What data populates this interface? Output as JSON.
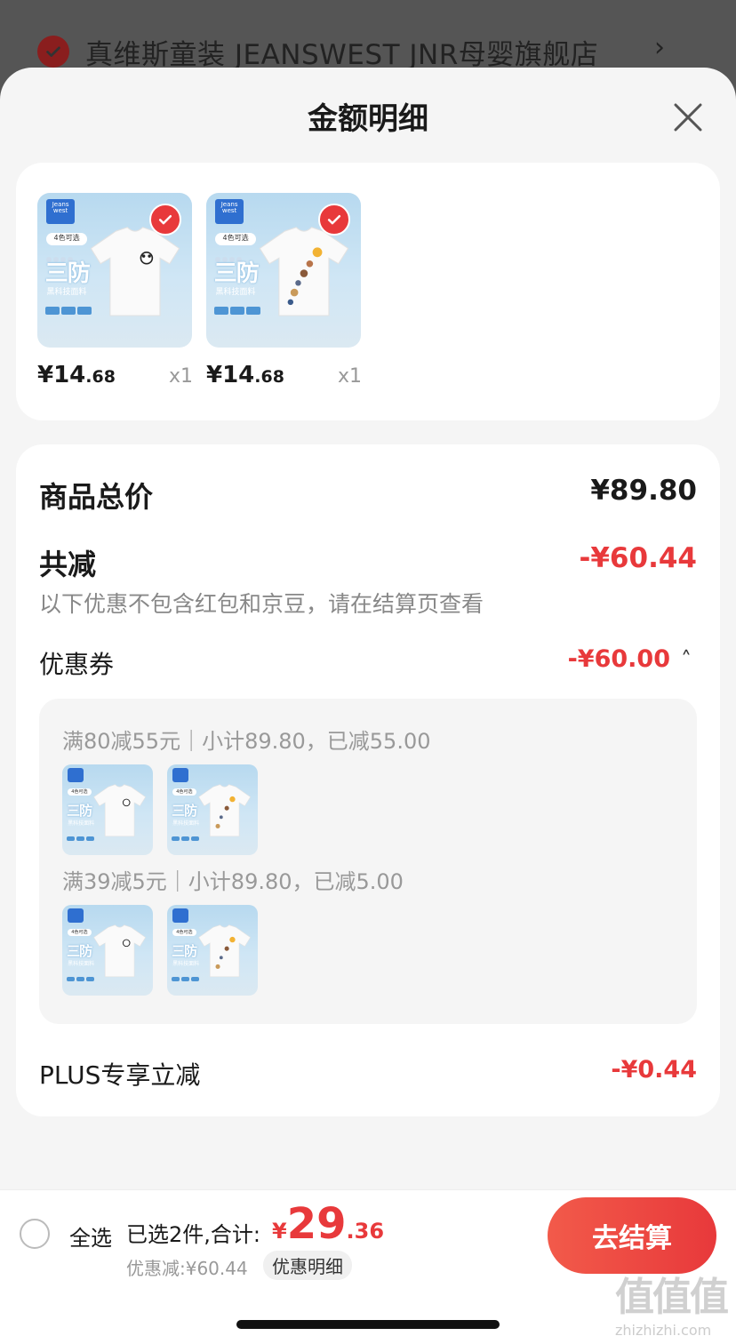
{
  "store": {
    "name": "真维斯童装 JEANSWEST JNR母婴旗舰店",
    "chevron": "›"
  },
  "sheet": {
    "title": "金额明细"
  },
  "products": [
    {
      "price_main": "¥14",
      "price_dec": ".68",
      "qty": "x1",
      "thumb": {
        "logo": "Jeans west",
        "tag": "4色可选",
        "big": "三防",
        "sub": "黑科技面料",
        "variant": "panda"
      }
    },
    {
      "price_main": "¥14",
      "price_dec": ".68",
      "qty": "x1",
      "thumb": {
        "logo": "Jeans west",
        "tag": "4色可选",
        "big": "三防",
        "sub": "黑科技面料",
        "variant": "planets"
      }
    }
  ],
  "summary": {
    "total_label": "商品总价",
    "total_value": "¥89.80",
    "reduce_label": "共减",
    "reduce_value": "-¥60.44",
    "reduce_hint": "以下优惠不包含红包和京豆，请在结算页查看",
    "coupon_label": "优惠券",
    "coupon_value": "-¥60.00",
    "coupon_toggle": "˄",
    "coupons": [
      {
        "text": "满80减55元｜小计89.80，已减55.00"
      },
      {
        "text": "满39减5元｜小计89.80，已减5.00"
      }
    ],
    "plus_label": "PLUS专享立减",
    "plus_value": "-¥0.44"
  },
  "bottom": {
    "select_all": "全选",
    "selected_text": "已选2件,合计:",
    "total_currency": "¥",
    "total_int": "29",
    "total_dec": ".36",
    "discount_text": "优惠减:¥60.44",
    "detail_chip": "优惠明细",
    "checkout_label": "去结算"
  },
  "watermark": {
    "big": "值值值",
    "small": "zhizhizhi.com"
  },
  "colors": {
    "accent": "#e8393b",
    "sheet_bg": "#f5f5f5",
    "overlay": "#4d4d4d"
  }
}
